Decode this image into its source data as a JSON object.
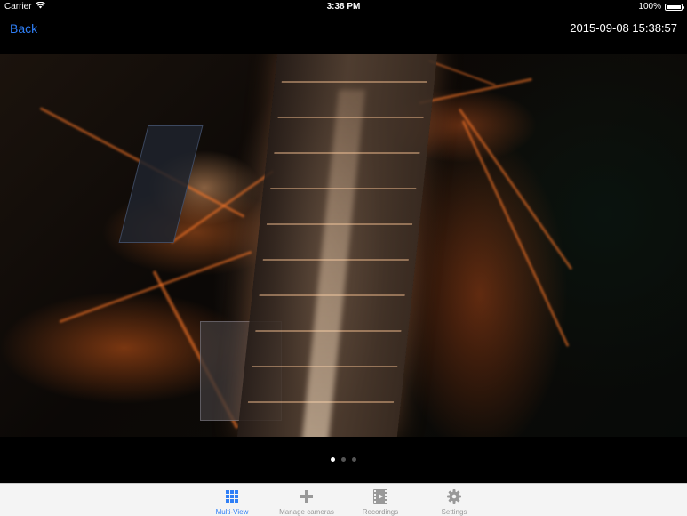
{
  "status_bar": {
    "carrier": "Carrier",
    "time": "3:38 PM",
    "battery_text": "100%",
    "battery_level": 1.0
  },
  "nav": {
    "back_label": "Back",
    "timestamp": "2015-09-08 15:38:57"
  },
  "pager": {
    "page_count": 3,
    "current_page": 1
  },
  "tabs": [
    {
      "label": "Multi-View",
      "icon": "grid-icon",
      "active": true
    },
    {
      "label": "Manage cameras",
      "icon": "plus-icon",
      "active": false
    },
    {
      "label": "Recordings",
      "icon": "film-icon",
      "active": false
    },
    {
      "label": "Settings",
      "icon": "gear-icon",
      "active": false
    }
  ],
  "colors": {
    "accent": "#2f7ff6",
    "inactive": "#999999",
    "tabbar_bg": "#f4f4f4"
  }
}
